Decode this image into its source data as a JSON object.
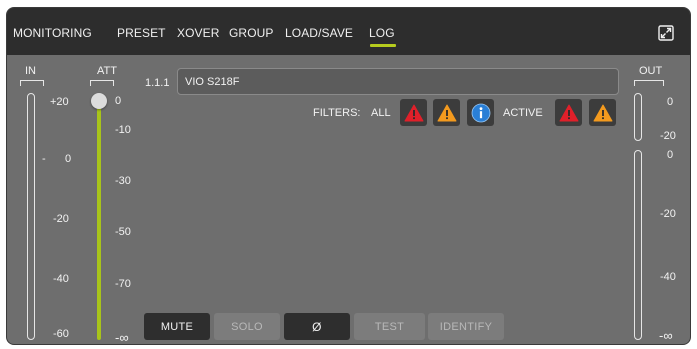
{
  "tabs": [
    {
      "label": "MONITORING",
      "active": false
    },
    {
      "label": "PRESET",
      "active": false
    },
    {
      "label": "XOVER",
      "active": false
    },
    {
      "label": "GROUP",
      "active": false
    },
    {
      "label": "LOAD/SAVE",
      "active": false
    },
    {
      "label": "LOG",
      "active": true
    }
  ],
  "header": {
    "expand_icon": "expand-icon"
  },
  "in_meter": {
    "label": "IN",
    "scale": [
      "+20",
      "0",
      "-20",
      "-40",
      "-60"
    ]
  },
  "att": {
    "label": "ATT",
    "scale": [
      "0",
      "-10",
      "-30",
      "-50",
      "-70",
      "-∞"
    ],
    "value": "0"
  },
  "device": {
    "id": "1.1.1",
    "name": "VIO S218F"
  },
  "filters": {
    "label": "FILTERS:",
    "all_label": "ALL",
    "active_label": "ACTIVE",
    "colors": {
      "error": "#e0202a",
      "warning": "#f39a1e",
      "info": "#2a7fd6"
    }
  },
  "out_meter": {
    "label": "OUT",
    "top_scale": [
      "0",
      "-20"
    ],
    "scale": [
      "0",
      "-20",
      "-40",
      "-∞"
    ]
  },
  "buttons": {
    "mute": "MUTE",
    "solo": "SOLO",
    "phase": "Ø",
    "test": "TEST",
    "identify": "IDENTIFY"
  },
  "accent_color": "#b6cc1e"
}
